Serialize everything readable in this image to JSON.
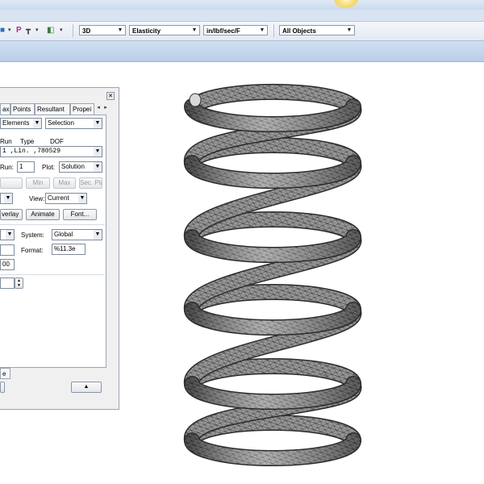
{
  "toolbar": {
    "view_mode": "3D",
    "material_property": "Elasticity",
    "units": "in/lbf/sec/F",
    "object_filter": "All Objects",
    "icons": [
      "layer-icon",
      "pen-icon",
      "tree-icon",
      "component-icon"
    ]
  },
  "panel": {
    "tabs": [
      "ax",
      "Points",
      "Resultant",
      "Propei"
    ],
    "close_icon": "close-icon",
    "entity_select": "Elements",
    "selection_select": "Selection",
    "run_header": "Run",
    "type_header": "Type",
    "dof_header": "DOF",
    "lcase_value": "1 ,Lin.   ,780529",
    "run_label": "Run:",
    "run_value": "1",
    "plot_label": "Plot:",
    "plot_select": "Solution",
    "min_button": "Min",
    "max_button": "Max",
    "sec_plane_button": "Sec. Plane",
    "view_label": "View:",
    "view_select": "Current",
    "overlay_button": "verlay",
    "animate_button": "Animate",
    "font_button": "Font...",
    "system_label": "System:",
    "system_select": "Global",
    "format_label": "Format:",
    "format_value": "%11.3e",
    "value_field": "00",
    "bottom_tab": "e"
  }
}
